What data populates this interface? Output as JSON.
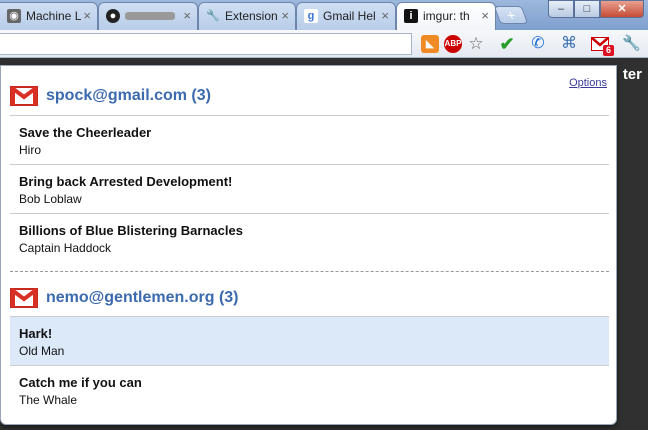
{
  "tabs": [
    {
      "title": "Machine L",
      "icon": "machine-icon",
      "active": false
    },
    {
      "title": "",
      "icon": "github-icon",
      "active": false
    },
    {
      "title": "Extension",
      "icon": "wrench-icon",
      "active": false
    },
    {
      "title": "Gmail Hel",
      "icon": "google-icon",
      "active": false
    },
    {
      "title": "imgur: th",
      "icon": "imgur-icon",
      "active": true
    }
  ],
  "toolbar": {
    "gmail_badge": "6"
  },
  "page_behind": {
    "text": "ter"
  },
  "popup": {
    "options_label": "Options",
    "accounts": [
      {
        "name": "spock@gmail.com (3)",
        "messages": [
          {
            "subject": "Save the Cheerleader",
            "sender": "Hiro"
          },
          {
            "subject": "Bring back Arrested Development!",
            "sender": "Bob Loblaw"
          },
          {
            "subject": "Billions of Blue Blistering Barnacles",
            "sender": "Captain Haddock"
          }
        ]
      },
      {
        "name": "nemo@gentlemen.org (3)",
        "messages": [
          {
            "subject": "Hark!",
            "sender": "Old Man",
            "highlighted": true
          },
          {
            "subject": "Catch me if you can",
            "sender": "The Whale"
          }
        ]
      }
    ]
  }
}
